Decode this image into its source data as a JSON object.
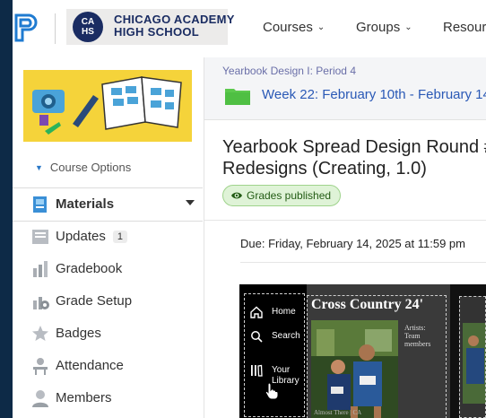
{
  "header": {
    "school_seal_text": "CA\nHS",
    "school_name": "CHICAGO ACADEMY\nHIGH SCHOOL",
    "nav": [
      {
        "label": "Courses"
      },
      {
        "label": "Groups"
      },
      {
        "label": "Resour"
      }
    ]
  },
  "sidebar": {
    "course_options": "Course Options",
    "items": [
      {
        "label": "Materials",
        "active": true
      },
      {
        "label": "Updates",
        "badge": "1"
      },
      {
        "label": "Gradebook"
      },
      {
        "label": "Grade Setup"
      },
      {
        "label": "Badges"
      },
      {
        "label": "Attendance"
      },
      {
        "label": "Members"
      }
    ]
  },
  "main": {
    "breadcrumb": "Yearbook Design I: Period 4",
    "folder": "Week 22: February 10th - February 14",
    "title": "Yearbook Spread Design Round #\nRedesigns (Creating, 1.0)",
    "status_pill": "Grades published",
    "due": "Due: Friday, February 14, 2025 at 11:59 pm"
  },
  "preview": {
    "nav": [
      {
        "label": "Home",
        "icon": "home-icon"
      },
      {
        "label": "Search",
        "icon": "search-icon"
      },
      {
        "label": "Your\nLibrary",
        "icon": "library-icon"
      }
    ],
    "title": "Cross Country 24'",
    "artists": "Artists:\nTeam\nmembers",
    "caption": "Almost There | CA"
  },
  "colors": {
    "accent_link": "#2a59b6",
    "published_bg": "#dff3d7",
    "course_banner": "#f5d33a",
    "folder_green": "#5cc94d"
  }
}
